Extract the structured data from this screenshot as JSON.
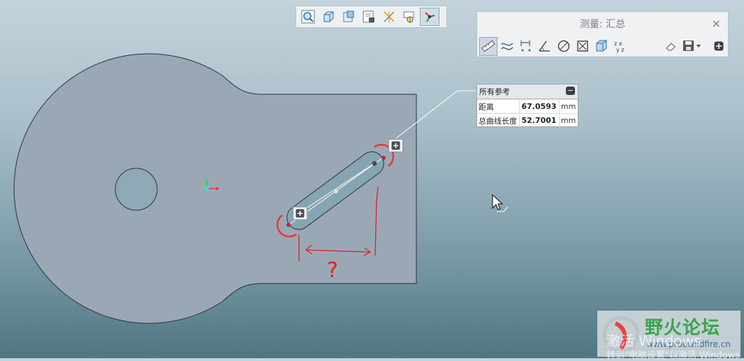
{
  "toolbar": {
    "icons": [
      "zoom-icon",
      "saved-view-icon",
      "named-view-icon",
      "appearance-icon",
      "datum-display-icon",
      "layer-icon",
      "spin-center-icon"
    ],
    "active": "spin-center-icon"
  },
  "measure_dialog": {
    "title": "测量: 汇总",
    "close": "×",
    "tools": [
      "length-icon",
      "curve-distance-icon",
      "distance-icon",
      "angle-icon",
      "diameter-icon",
      "area-icon",
      "volume-icon",
      "transform-icon"
    ],
    "active_tool": "length-icon"
  },
  "results": {
    "header": "所有参考",
    "rows": [
      {
        "label": "距离",
        "value": "67.0593",
        "unit": "mm"
      },
      {
        "label": "总曲线长度",
        "value": "52.7001",
        "unit": "mm"
      }
    ]
  },
  "annotation": {
    "question": "?",
    "color": "#e02020"
  },
  "colors": {
    "part_fill": "#9aa8b6",
    "highlight": "#e53935",
    "origin_x": "#ff3333",
    "origin_y": "#22cc44"
  },
  "watermark": {
    "brand": "野火论坛",
    "site": "www.proewildfire.cn"
  },
  "windows_activation": {
    "line1_a": "激活",
    "line1_b": "Windows",
    "line2": "转到\"电脑设置\"以激活 Windows"
  }
}
